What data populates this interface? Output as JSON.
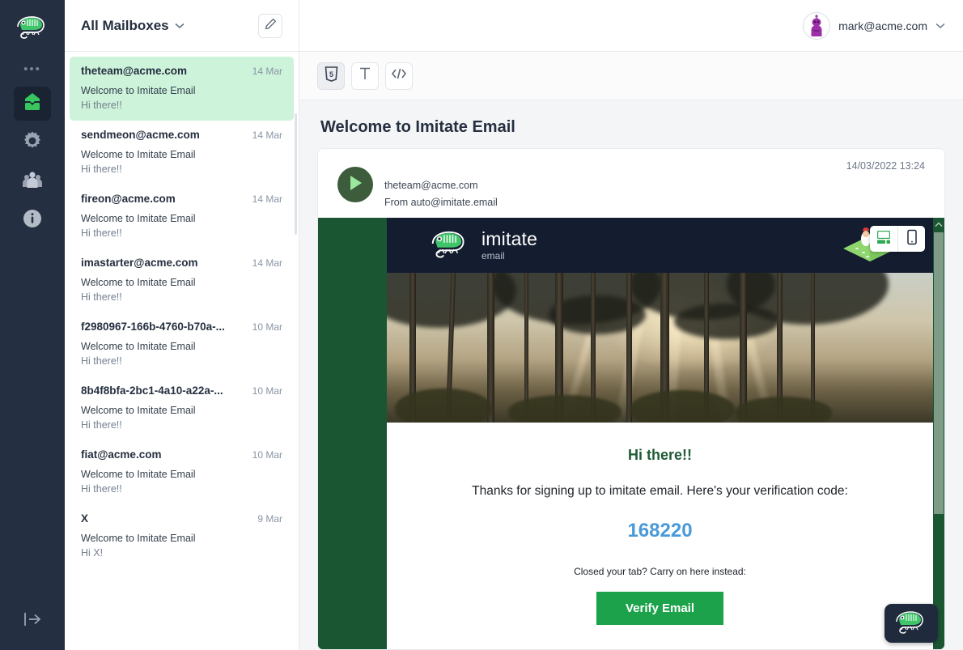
{
  "rail": {
    "logo_icon": "chameleon-logo",
    "dots": "•••",
    "items": [
      {
        "name": "mailbox",
        "icon": "inbox-icon",
        "active": true
      },
      {
        "name": "settings",
        "icon": "gear-icon",
        "active": false
      },
      {
        "name": "team",
        "icon": "people-icon",
        "active": false
      },
      {
        "name": "info",
        "icon": "info-icon",
        "active": false
      }
    ],
    "logout_icon": "logout-arrow-icon"
  },
  "mail_list": {
    "mailbox_label": "All Mailboxes",
    "mailbox_caret_icon": "chevron-down-icon",
    "compose_icon": "pencil-icon",
    "items": [
      {
        "from": "theteam@acme.com",
        "date": "14 Mar",
        "subject": "Welcome to Imitate Email",
        "preview": "Hi there!!",
        "selected": true
      },
      {
        "from": "sendmeon@acme.com",
        "date": "14 Mar",
        "subject": "Welcome to Imitate Email",
        "preview": "Hi there!!",
        "selected": false
      },
      {
        "from": "fireon@acme.com",
        "date": "14 Mar",
        "subject": "Welcome to Imitate Email",
        "preview": "Hi there!!",
        "selected": false
      },
      {
        "from": "imastarter@acme.com",
        "date": "14 Mar",
        "subject": "Welcome to Imitate Email",
        "preview": "Hi there!!",
        "selected": false
      },
      {
        "from": "f2980967-166b-4760-b70a-...",
        "date": "10 Mar",
        "subject": "Welcome to Imitate Email",
        "preview": "Hi there!!",
        "selected": false
      },
      {
        "from": "8b4f8bfa-2bc1-4a10-a22a-...",
        "date": "10 Mar",
        "subject": "Welcome to Imitate Email",
        "preview": "Hi there!!",
        "selected": false
      },
      {
        "from": "fiat@acme.com",
        "date": "10 Mar",
        "subject": "Welcome to Imitate Email",
        "preview": "Hi there!!",
        "selected": false
      },
      {
        "from": "X",
        "date": "9 Mar",
        "subject": "Welcome to Imitate Email",
        "preview": "Hi X!",
        "selected": false
      }
    ]
  },
  "topbar": {
    "user_email": "mark@acme.com",
    "caret_icon": "chevron-down-icon",
    "avatar_icon": "user-avatar"
  },
  "toolbar": {
    "buttons": [
      {
        "label": "html-view",
        "icon": "html5-shield-icon",
        "active": true
      },
      {
        "label": "text-view",
        "icon": "text-t-icon",
        "active": false
      },
      {
        "label": "source-view",
        "icon": "code-brackets-icon",
        "active": false
      }
    ]
  },
  "message": {
    "subject": "Welcome to Imitate Email",
    "to": "theteam@acme.com",
    "from": "From auto@imitate.email",
    "datetime": "14/03/2022 13:24",
    "sender_avatar_icon": "play-triangle-icon"
  },
  "email_body": {
    "brand_name": "imitate",
    "brand_sub": "email",
    "logo_icon": "chameleon-logo",
    "illustration_icon": "isometric-island-icon",
    "greeting": "Hi there!!",
    "intro": "Thanks for signing up to imitate email. Here's your verification code:",
    "code": "168220",
    "closed_tab_text": "Closed your tab? Carry on here instead:",
    "verify_button": "Verify Email"
  },
  "view_toggle": {
    "desktop_icon": "desktop-monitor-icon",
    "mobile_icon": "mobile-phone-icon",
    "active": "desktop"
  },
  "scroll": {
    "up_icon": "chevron-up-icon"
  },
  "widget": {
    "icon": "chameleon-logo"
  },
  "colors": {
    "rail_bg": "#242f41",
    "selected_mail": "#cdf3da",
    "accent_green": "#2fc25b",
    "email_green": "#1b5632",
    "banner_navy": "#141c2f",
    "code_blue": "#4a9ad8",
    "verify_green": "#1ba24a"
  }
}
